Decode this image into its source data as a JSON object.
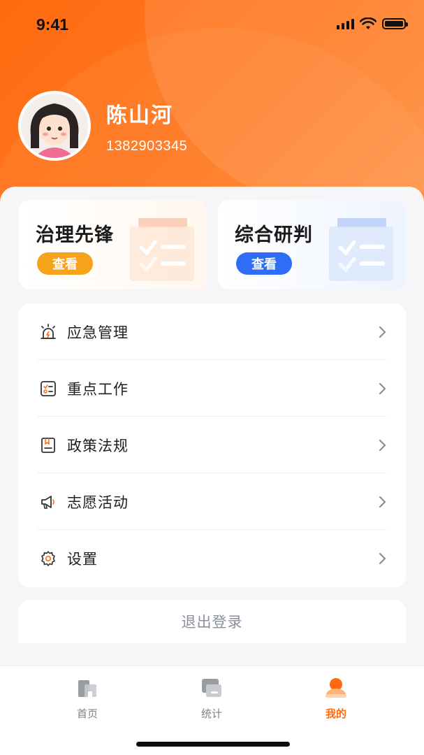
{
  "status_bar": {
    "time": "9:41"
  },
  "profile": {
    "name": "陈山河",
    "phone": "1382903345"
  },
  "feature_cards": [
    {
      "title": "治理先锋",
      "button": "查看",
      "accent": "#f6a21b"
    },
    {
      "title": "综合研判",
      "button": "查看",
      "accent": "#2f6df6"
    }
  ],
  "menu": {
    "items": [
      {
        "label": "应急管理",
        "icon": "alarm-light-icon"
      },
      {
        "label": "重点工作",
        "icon": "checklist-icon"
      },
      {
        "label": "政策法规",
        "icon": "document-book-icon"
      },
      {
        "label": "志愿活动",
        "icon": "megaphone-icon"
      },
      {
        "label": "设置",
        "icon": "gear-icon"
      }
    ]
  },
  "logout": {
    "label": "退出登录"
  },
  "tabs": [
    {
      "label": "首页",
      "icon": "home-icon",
      "active": false
    },
    {
      "label": "统计",
      "icon": "stats-icon",
      "active": false
    },
    {
      "label": "我的",
      "icon": "profile-icon",
      "active": true
    }
  ],
  "colors": {
    "brand": "#ff6a10",
    "orange_button": "#f6a21b",
    "blue_button": "#2f6df6",
    "inactive_tab": "#7d7f85"
  }
}
